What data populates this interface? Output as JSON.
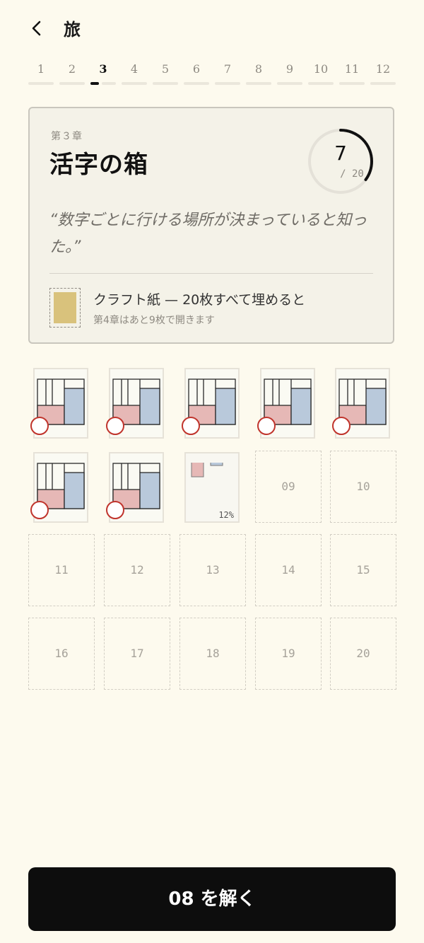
{
  "header": {
    "back_icon": "chevron-left-icon",
    "title": "旅"
  },
  "chapters": [
    "1",
    "2",
    "3",
    "4",
    "5",
    "6",
    "7",
    "8",
    "9",
    "10",
    "11",
    "12"
  ],
  "active_chapter": "3",
  "card": {
    "chapter_label": "第３章",
    "title": "活字の箱",
    "progress": {
      "count": "7",
      "total": "/ 20",
      "fraction": 0.35
    },
    "quote": "“数字ごとに行ける場所が決まっていると知った。”",
    "reward": {
      "title": "クラフト紙 — 20枚すべて埋めると",
      "note": "第4章はあと9枚で開きます",
      "swatch_color": "#d9c27c"
    }
  },
  "cells": {
    "in_progress": {
      "label": "12%",
      "progress": 0.12
    },
    "locked": [
      "09",
      "10",
      "11",
      "12",
      "13",
      "14",
      "15",
      "16",
      "17",
      "18",
      "19",
      "20"
    ]
  },
  "completed_count": 7,
  "cta": {
    "label": "08 を解く"
  },
  "colors": {
    "stamp": "#c0342c",
    "pink": "#e6b8b6",
    "blue": "#b9c9db",
    "cream": "#fdfaee"
  }
}
